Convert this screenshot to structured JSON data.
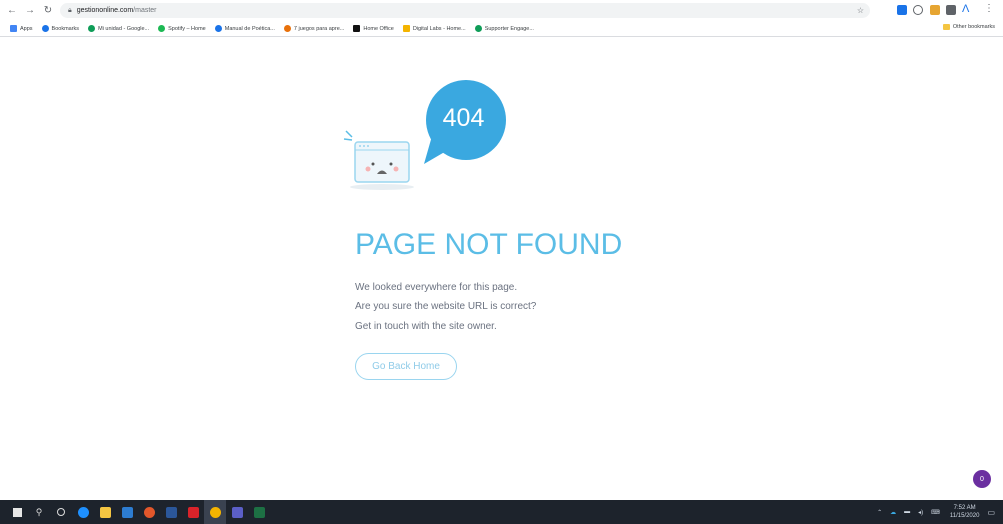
{
  "browser": {
    "url_host": "gestiononline.com",
    "url_path": "/master",
    "bookmarks": [
      {
        "label": "Apps",
        "color": "#4285f4"
      },
      {
        "label": "Bookmarks",
        "color": "#1a73e8"
      },
      {
        "label": "Mi unidad - Google...",
        "color": "#0f9d58"
      },
      {
        "label": "Spotify – Home",
        "color": "#1db954"
      },
      {
        "label": "Manual de Poética...",
        "color": "#1a73e8"
      },
      {
        "label": "7 juegos para apre...",
        "color": "#e8710a"
      },
      {
        "label": "Home Office",
        "color": "#111111"
      },
      {
        "label": "Digital Labs - Home...",
        "color": "#f4b400"
      },
      {
        "label": "Supporter Engage...",
        "color": "#0f9d58"
      }
    ],
    "other_bookmarks": "Other bookmarks"
  },
  "page": {
    "code": "404",
    "title": "PAGE NOT FOUND",
    "lines": [
      "We looked everywhere for this page.",
      "Are you sure the website URL is correct?",
      "Get in touch with the site owner."
    ],
    "home_button": "Go Back Home",
    "chat_badge": "0"
  },
  "taskbar": {
    "time": "7:52 AM",
    "date": "11/15/2020"
  },
  "colors": {
    "accent": "#5bbde6",
    "bubble": "#3aa8e0"
  }
}
